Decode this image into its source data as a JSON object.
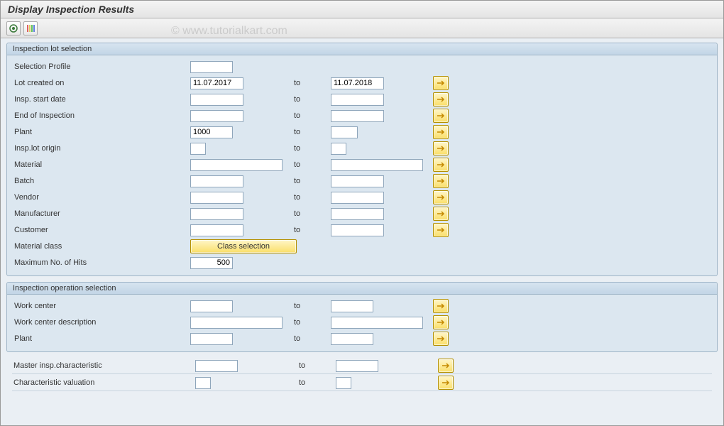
{
  "title": "Display Inspection Results",
  "watermark": "© www.tutorialkart.com",
  "labels": {
    "to": "to"
  },
  "group1": {
    "title": "Inspection lot selection",
    "rows": {
      "selection_profile": {
        "label": "Selection Profile",
        "from": ""
      },
      "lot_created": {
        "label": "Lot created on",
        "from": "11.07.2017",
        "to": "11.07.2018"
      },
      "insp_start": {
        "label": "Insp. start date",
        "from": "",
        "to": ""
      },
      "end_of_insp": {
        "label": "End of Inspection",
        "from": "",
        "to": ""
      },
      "plant": {
        "label": "Plant",
        "from": "1000",
        "to": ""
      },
      "lot_origin": {
        "label": "Insp.lot origin",
        "from": "",
        "to": ""
      },
      "material": {
        "label": "Material",
        "from": "",
        "to": ""
      },
      "batch": {
        "label": "Batch",
        "from": "",
        "to": ""
      },
      "vendor": {
        "label": "Vendor",
        "from": "",
        "to": ""
      },
      "manufacturer": {
        "label": "Manufacturer",
        "from": "",
        "to": ""
      },
      "customer": {
        "label": "Customer",
        "from": "",
        "to": ""
      },
      "material_class": {
        "label": "Material class",
        "button": "Class selection"
      },
      "max_hits": {
        "label": "Maximum No. of Hits",
        "value": "500"
      }
    }
  },
  "group2": {
    "title": "Inspection operation selection",
    "rows": {
      "work_center": {
        "label": "Work center",
        "from": "",
        "to": ""
      },
      "work_center_desc": {
        "label": "Work center description",
        "from": "",
        "to": ""
      },
      "plant": {
        "label": "Plant",
        "from": "",
        "to": ""
      }
    }
  },
  "flat": {
    "master_char": {
      "label": "Master insp.characteristic",
      "from": "",
      "to": ""
    },
    "char_valuation": {
      "label": "Characteristic valuation",
      "from": "",
      "to": ""
    }
  }
}
